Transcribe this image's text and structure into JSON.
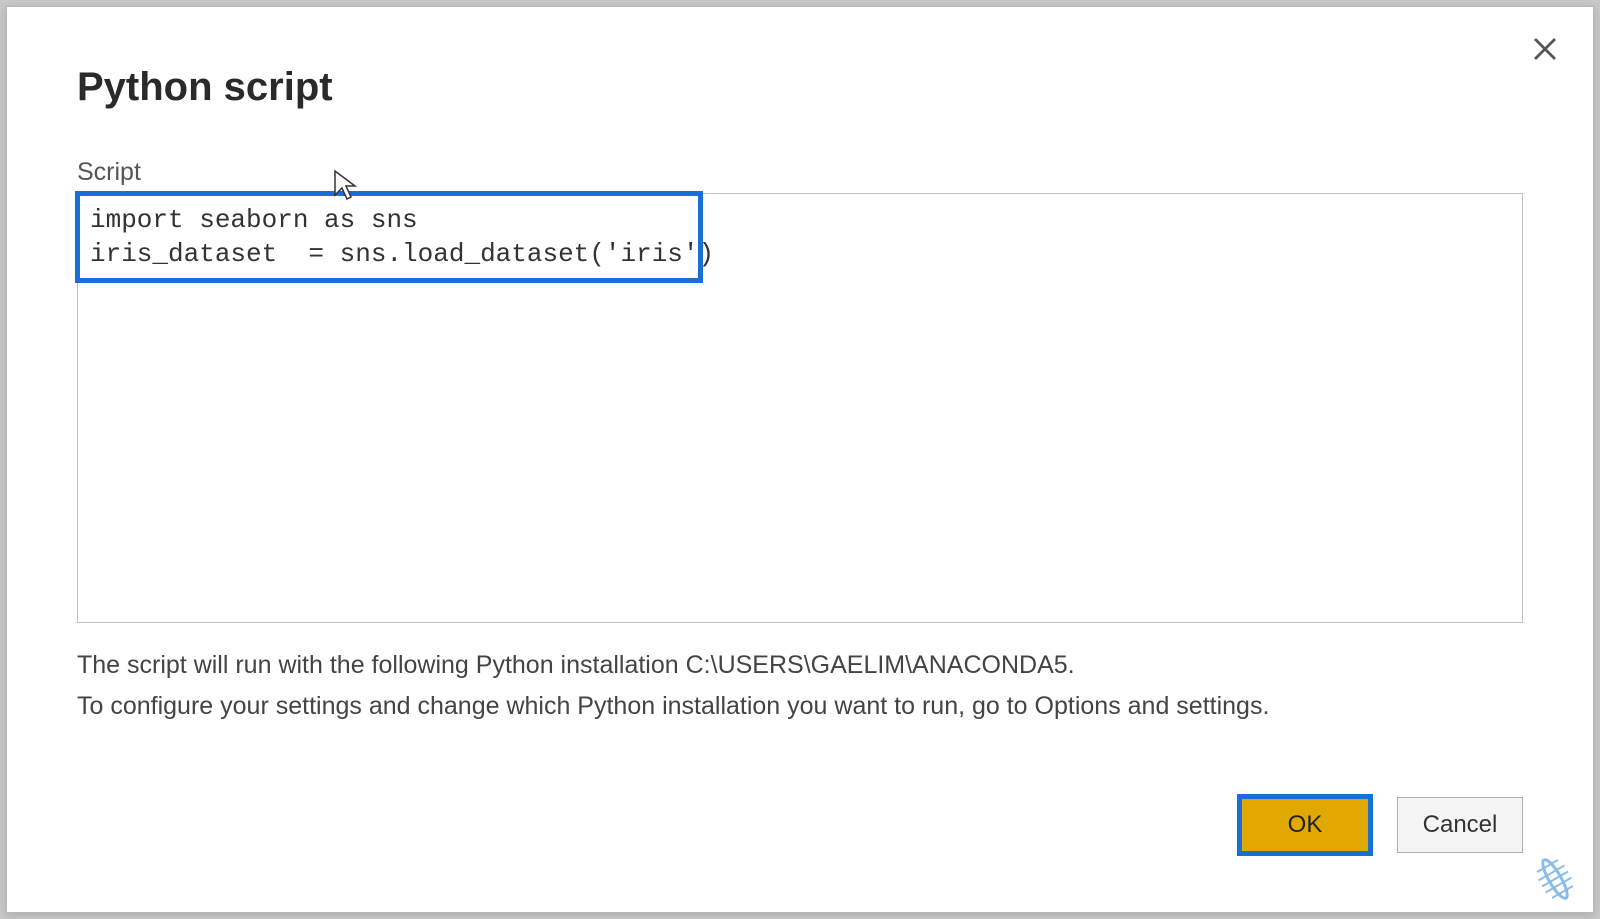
{
  "dialog": {
    "title": "Python script",
    "script_label": "Script",
    "script_value": "import seaborn as sns\niris_dataset  = sns.load_dataset('iris')",
    "info_line1": "The script will run with the following Python installation C:\\USERS\\GAELIM\\ANACONDA5.",
    "info_line2": "To configure your settings and change which Python installation you want to run, go to Options and settings.",
    "ok_label": "OK",
    "cancel_label": "Cancel"
  }
}
